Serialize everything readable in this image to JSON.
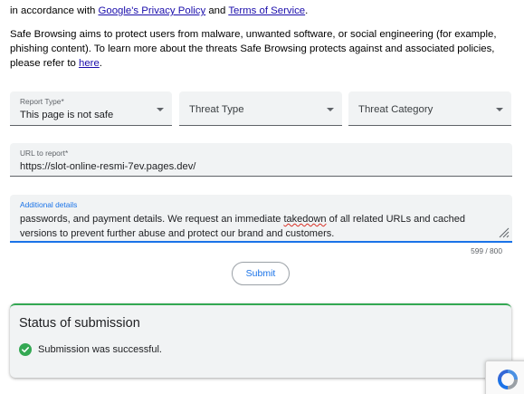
{
  "intro": {
    "line1_prefix": "in accordance with ",
    "privacy_link": "Google's Privacy Policy",
    "and": " and ",
    "terms_link": "Terms of Service",
    "period": ".",
    "para2_text": "Safe Browsing aims to protect users from malware, unwanted software, or social engineering (for example, phishing content). To learn more about the threats Safe Browsing protects against and associated policies, please refer to ",
    "here_link": "here",
    "para2_end": "."
  },
  "form": {
    "report_type": {
      "label": "Report Type*",
      "value": "This page is not safe"
    },
    "threat_type": {
      "placeholder": "Threat Type"
    },
    "threat_category": {
      "placeholder": "Threat Category"
    },
    "url": {
      "label": "URL to report*",
      "value": "https://slot-online-resmi-7ev.pages.dev/"
    },
    "details": {
      "label": "Additional details",
      "text_before": "passwords, and payment details. We request an immediate ",
      "misspelled": "takedown",
      "text_after": " of all related URLs and cached versions to prevent further abuse and protect our brand and customers."
    },
    "counter": "599 / 800",
    "submit_label": "Submit"
  },
  "status": {
    "title": "Status of submission",
    "message": "Submission was successful.",
    "accent_color": "#34a853"
  },
  "recaptcha_icon": "recaptcha-icon"
}
